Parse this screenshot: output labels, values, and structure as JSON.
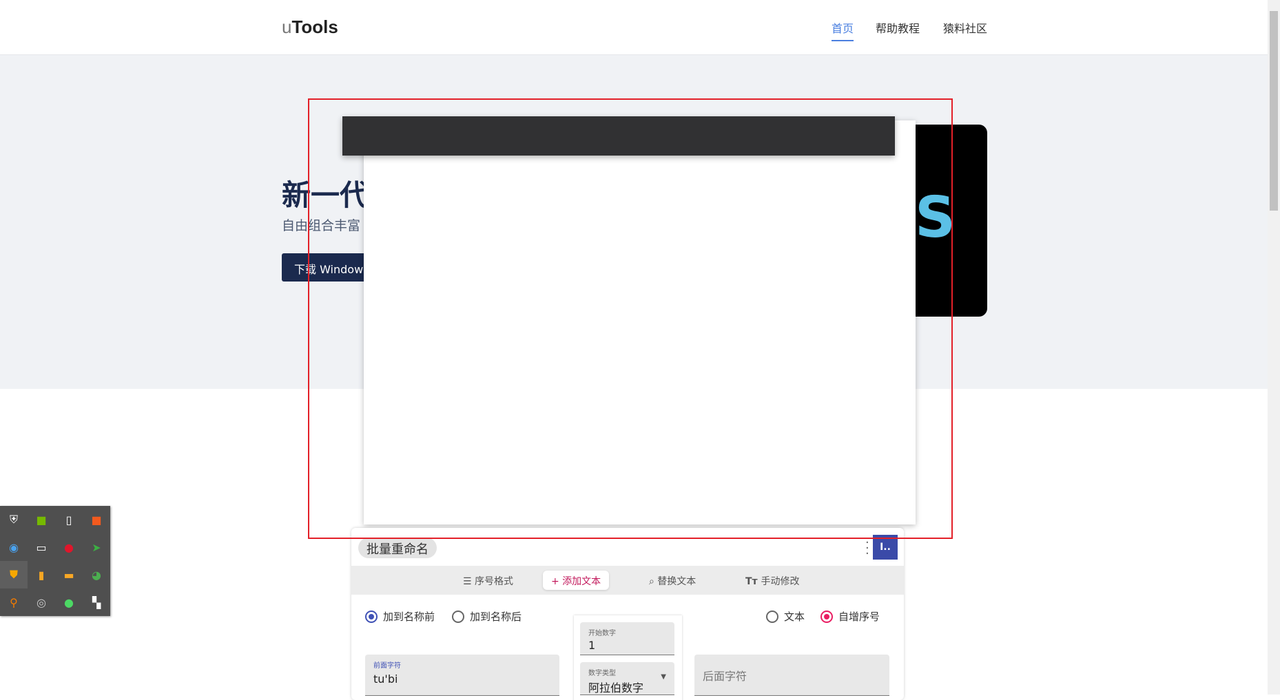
{
  "header": {
    "logo_u": "u",
    "logo_rest": "Tools",
    "nav": [
      "首页",
      "帮助教程",
      "猿料社区"
    ]
  },
  "hero": {
    "title": "新一代",
    "subtitle": "自由组合丰富",
    "download_button": "下载 Windows",
    "image_letter": "S"
  },
  "app": {
    "title": "批量重命名",
    "avatar": "I..",
    "tabs": [
      "序号格式",
      "添加文本",
      "替换文本",
      "手动修改"
    ],
    "active_tab": "添加文本",
    "position_options": [
      "加到名称前",
      "加到名称后"
    ],
    "type_options": [
      "文本",
      "自增序号"
    ],
    "start_number": {
      "label": "开始数字",
      "value": "1"
    },
    "number_type": {
      "label": "数字类型",
      "value": "阿拉伯数字"
    },
    "prefix": {
      "label": "前面字符",
      "value": "tu'bi"
    },
    "suffix": {
      "placeholder": "后面字符"
    }
  },
  "colors": {
    "accent": "#4a7fe0",
    "navy": "#1b2a4e",
    "selection": "#e32028",
    "pink": "#e91e63",
    "indigo": "#3f51b5"
  },
  "tray_icons": [
    "security-shield-icon",
    "nvidia-icon",
    "usb-drive-icon",
    "media-player-icon",
    "baidu-netdisk-icon",
    "network-icon",
    "netease-music-icon",
    "cursor-arrow-icon",
    "huorong-shield-icon",
    "usb-icon",
    "window-app-icon",
    "download-manager-icon",
    "search-icon",
    "utility-icon",
    "wechat-icon",
    "bookmark-icon"
  ]
}
